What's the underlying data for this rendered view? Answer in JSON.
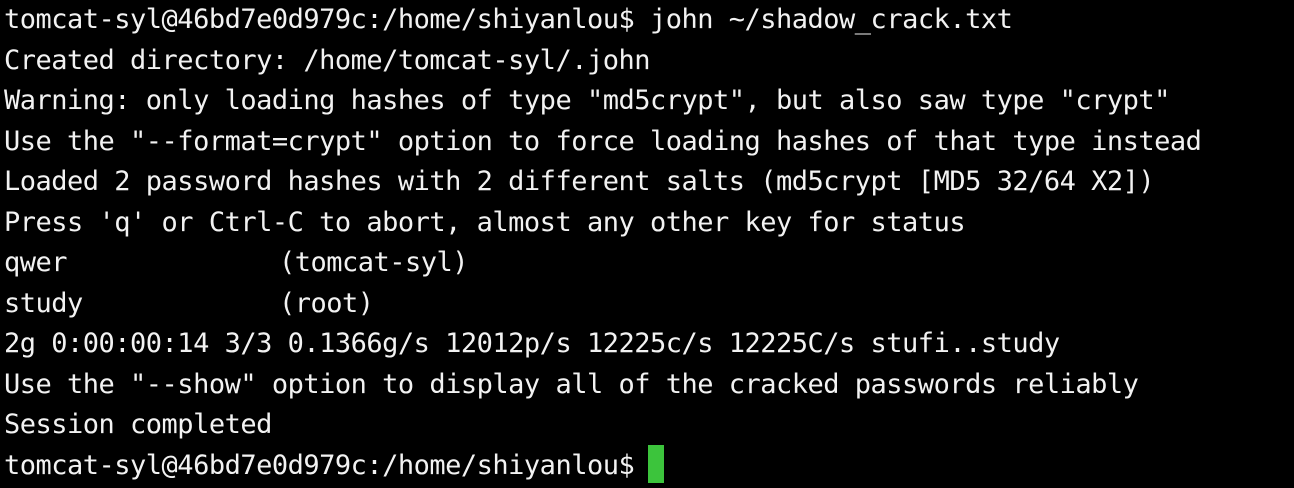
{
  "terminal": {
    "prompt": "tomcat-syl@46bd7e0d979c:/home/shiyanlou$",
    "command": "john ~/shadow_crack.txt",
    "output": [
      "Created directory: /home/tomcat-syl/.john",
      "Warning: only loading hashes of type \"md5crypt\", but also saw type \"crypt\"",
      "Use the \"--format=crypt\" option to force loading hashes of that type instead",
      "Loaded 2 password hashes with 2 different salts (md5crypt [MD5 32/64 X2])",
      "Press 'q' or Ctrl-C to abort, almost any other key for status"
    ],
    "cracked": [
      {
        "password": "qwer",
        "user": "(tomcat-syl)"
      },
      {
        "password": "study",
        "user": "(root)"
      }
    ],
    "summary": [
      "2g 0:00:00:14 3/3 0.1366g/s 12012p/s 12225c/s 12225C/s stufi..study",
      "Use the \"--show\" option to display all of the cracked passwords reliably",
      "Session completed"
    ],
    "final_prompt": "tomcat-syl@46bd7e0d979c:/home/shiyanlou$",
    "cursor_color": "#3cc43c",
    "background_color": "#000000",
    "text_color": "#f2f2f2"
  }
}
